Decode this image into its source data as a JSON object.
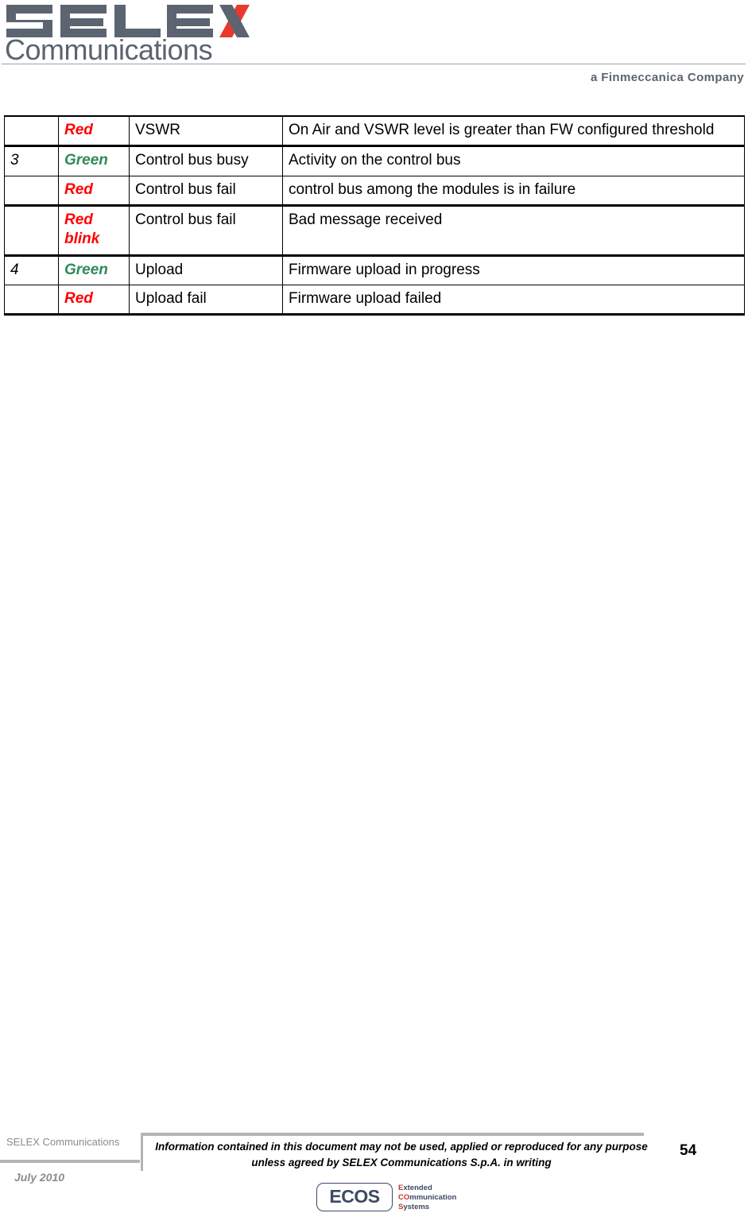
{
  "header": {
    "logo_primary": "SELEX",
    "logo_secondary": "Communications",
    "tagline": "a Finmeccanica Company"
  },
  "table": {
    "columns": [
      "led-number",
      "color",
      "name",
      "description"
    ],
    "rows": [
      {
        "num": "",
        "color": "Red",
        "color_kind": "red",
        "name": "VSWR",
        "desc": "On Air and VSWR level is greater than FW configured threshold",
        "justify": true,
        "group_start": false,
        "first": true,
        "last": false
      },
      {
        "num": "3",
        "color": "Green",
        "color_kind": "green",
        "name": "Control bus busy",
        "desc": "Activity on the control bus",
        "justify": false,
        "group_start": true,
        "first": false,
        "last": false
      },
      {
        "num": "",
        "color": "Red",
        "color_kind": "red",
        "name": "Control bus fail",
        "desc": "control bus among the modules is in failure",
        "justify": false,
        "group_start": false,
        "first": false,
        "last": false
      },
      {
        "num": "",
        "color": "Red",
        "color_line2": "blink",
        "color_kind": "red",
        "name": "Control bus fail",
        "desc": "Bad message received",
        "justify": false,
        "group_start": true,
        "first": false,
        "last": false
      },
      {
        "num": "4",
        "color": "Green",
        "color_kind": "green",
        "name": "Upload",
        "desc": "Firmware upload in progress",
        "justify": false,
        "group_start": true,
        "first": false,
        "last": false
      },
      {
        "num": "",
        "color": "Red",
        "color_kind": "red",
        "name": "Upload fail",
        "desc": "Firmware upload failed",
        "justify": false,
        "group_start": false,
        "first": false,
        "last": true
      }
    ]
  },
  "footer": {
    "company": "SELEX Communications",
    "date": "July 2010",
    "notice": "Information contained in this document may not be used, applied or reproduced for any purpose unless agreed by SELEX Communications S.p.A. in writing",
    "page_number": "54",
    "ecos": {
      "word": "ECOS",
      "line1_cap": "E",
      "line1_rest": "xtended",
      "line2_cap": "CO",
      "line2_rest": "mmunication",
      "line3_cap": "S",
      "line3_rest": "ystems"
    }
  },
  "colors": {
    "led_red": "#ff0000",
    "led_green": "#2e8b57",
    "brand_gray": "#5b6470",
    "brand_red": "#e8392c",
    "footer_gray": "#8b8b8b",
    "ecos_navy": "#3c4a63",
    "ecos_red": "#c0392b"
  }
}
